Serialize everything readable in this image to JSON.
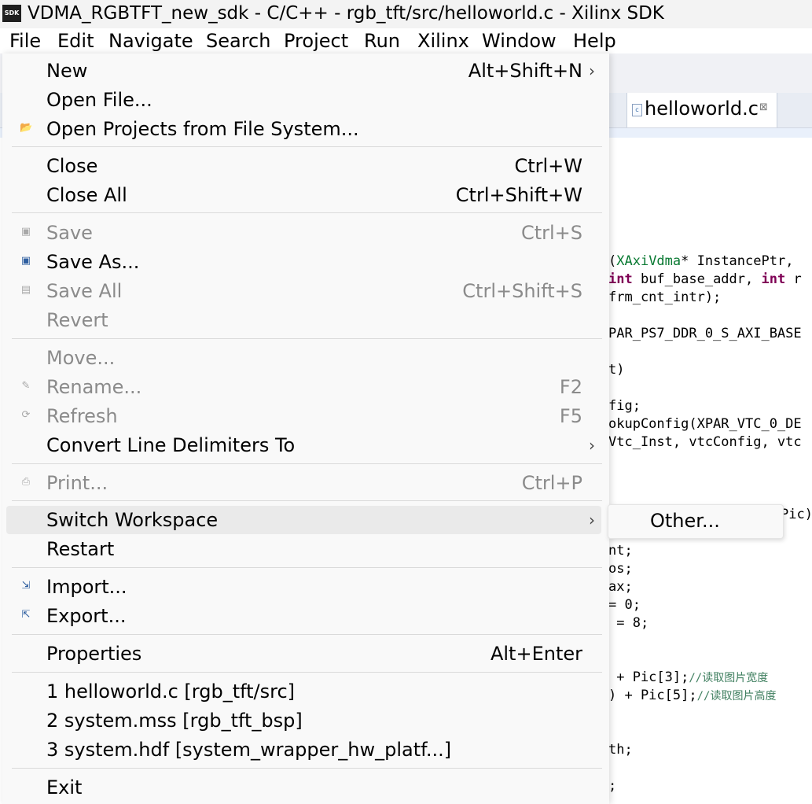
{
  "window": {
    "title": "VDMA_RGBTFT_new_sdk - C/C++ - rgb_tft/src/helloworld.c - Xilinx SDK",
    "app_icon_text": "SDK"
  },
  "menubar": [
    "File",
    "Edit",
    "Navigate",
    "Search",
    "Project",
    "Run",
    "Xilinx",
    "Window",
    "Help"
  ],
  "editor": {
    "tab_label": "helloworld.c",
    "tab_close": "⊠",
    "code_lines": [
      {
        "segments": [
          {
            "t": "(",
            "c": ""
          },
          {
            "t": "XAxiVdma",
            "c": "ty"
          },
          {
            "t": "* InstancePtr,",
            "c": ""
          }
        ]
      },
      {
        "segments": [
          {
            "t": "int",
            "c": "kw"
          },
          {
            "t": " buf_base_addr, ",
            "c": ""
          },
          {
            "t": "int",
            "c": "kw"
          },
          {
            "t": " r",
            "c": ""
          }
        ]
      },
      {
        "segments": [
          {
            "t": "frm_cnt_intr);",
            "c": ""
          }
        ]
      },
      {
        "segments": []
      },
      {
        "segments": [
          {
            "t": "PAR_PS7_DDR_0_S_AXI_BASE",
            "c": ""
          }
        ]
      },
      {
        "segments": []
      },
      {
        "segments": [
          {
            "t": "t)",
            "c": ""
          }
        ]
      },
      {
        "segments": []
      },
      {
        "segments": [
          {
            "t": "fig;",
            "c": ""
          }
        ]
      },
      {
        "segments": [
          {
            "t": "okupConfig(XPAR_VTC_0_DE",
            "c": ""
          }
        ]
      },
      {
        "segments": [
          {
            "t": "Vtc_Inst, vtcConfig, vtc",
            "c": ""
          }
        ]
      },
      {
        "segments": []
      },
      {
        "segments": []
      },
      {
        "segments": [
          {
            "t": "Pic)",
            "c": ""
          }
        ]
      },
      {
        "segments": []
      },
      {
        "segments": [
          {
            "t": "nt;",
            "c": ""
          }
        ]
      },
      {
        "segments": [
          {
            "t": "os;",
            "c": ""
          }
        ]
      },
      {
        "segments": [
          {
            "t": "ax;",
            "c": ""
          }
        ]
      },
      {
        "segments": [
          {
            "t": "= 0;",
            "c": ""
          }
        ]
      },
      {
        "segments": [
          {
            "t": " = 8;",
            "c": ""
          }
        ]
      },
      {
        "segments": []
      },
      {
        "segments": []
      },
      {
        "segments": [
          {
            "t": " + Pic[3];",
            "c": ""
          },
          {
            "t": "//读取图片宽度",
            "c": "cm"
          }
        ]
      },
      {
        "segments": [
          {
            "t": ") + Pic[5];",
            "c": ""
          },
          {
            "t": "//读取图片高度",
            "c": "cm"
          }
        ]
      },
      {
        "segments": []
      },
      {
        "segments": []
      },
      {
        "segments": [
          {
            "t": "th;",
            "c": ""
          }
        ]
      },
      {
        "segments": []
      },
      {
        "segments": []
      },
      {
        "segments": [
          {
            "t": ";",
            "c": ""
          }
        ]
      }
    ]
  },
  "file_menu": {
    "items": [
      {
        "label": "New",
        "accel": "Alt+Shift+N",
        "submenu": true,
        "disabled": false,
        "icon": ""
      },
      {
        "label": "Open File...",
        "accel": "",
        "submenu": false,
        "disabled": false,
        "icon": ""
      },
      {
        "label": "Open Projects from File System...",
        "accel": "",
        "submenu": false,
        "disabled": false,
        "icon": "folder-icon"
      },
      {
        "label": "Close",
        "accel": "Ctrl+W",
        "submenu": false,
        "disabled": false,
        "icon": ""
      },
      {
        "label": "Close All",
        "accel": "Ctrl+Shift+W",
        "submenu": false,
        "disabled": false,
        "icon": ""
      },
      {
        "label": "Save",
        "accel": "Ctrl+S",
        "submenu": false,
        "disabled": true,
        "icon": "save-icon"
      },
      {
        "label": "Save As...",
        "accel": "",
        "submenu": false,
        "disabled": false,
        "icon": "save-as-icon"
      },
      {
        "label": "Save All",
        "accel": "Ctrl+Shift+S",
        "submenu": false,
        "disabled": true,
        "icon": "save-all-icon"
      },
      {
        "label": "Revert",
        "accel": "",
        "submenu": false,
        "disabled": true,
        "icon": ""
      },
      {
        "label": "Move...",
        "accel": "",
        "submenu": false,
        "disabled": true,
        "icon": ""
      },
      {
        "label": "Rename...",
        "accel": "F2",
        "submenu": false,
        "disabled": true,
        "icon": "rename-icon"
      },
      {
        "label": "Refresh",
        "accel": "F5",
        "submenu": false,
        "disabled": true,
        "icon": "refresh-icon"
      },
      {
        "label": "Convert Line Delimiters To",
        "accel": "",
        "submenu": true,
        "disabled": false,
        "icon": ""
      },
      {
        "label": "Print...",
        "accel": "Ctrl+P",
        "submenu": false,
        "disabled": true,
        "icon": "print-icon"
      },
      {
        "label": "Switch Workspace",
        "accel": "",
        "submenu": true,
        "disabled": false,
        "icon": "",
        "highlighted": true
      },
      {
        "label": "Restart",
        "accel": "",
        "submenu": false,
        "disabled": false,
        "icon": ""
      },
      {
        "label": "Import...",
        "accel": "",
        "submenu": false,
        "disabled": false,
        "icon": "import-icon"
      },
      {
        "label": "Export...",
        "accel": "",
        "submenu": false,
        "disabled": false,
        "icon": "export-icon"
      },
      {
        "label": "Properties",
        "accel": "Alt+Enter",
        "submenu": false,
        "disabled": false,
        "icon": ""
      },
      {
        "label": "1 helloworld.c  [rgb_tft/src]",
        "accel": "",
        "submenu": false,
        "disabled": false,
        "icon": ""
      },
      {
        "label": "2 system.mss  [rgb_tft_bsp]",
        "accel": "",
        "submenu": false,
        "disabled": false,
        "icon": ""
      },
      {
        "label": "3 system.hdf  [system_wrapper_hw_platf...]",
        "accel": "",
        "submenu": false,
        "disabled": false,
        "icon": ""
      },
      {
        "label": "Exit",
        "accel": "",
        "submenu": false,
        "disabled": false,
        "icon": ""
      }
    ],
    "submenu_arrow": "›"
  },
  "switch_workspace_submenu": {
    "items": [
      {
        "label": "Other..."
      }
    ]
  }
}
